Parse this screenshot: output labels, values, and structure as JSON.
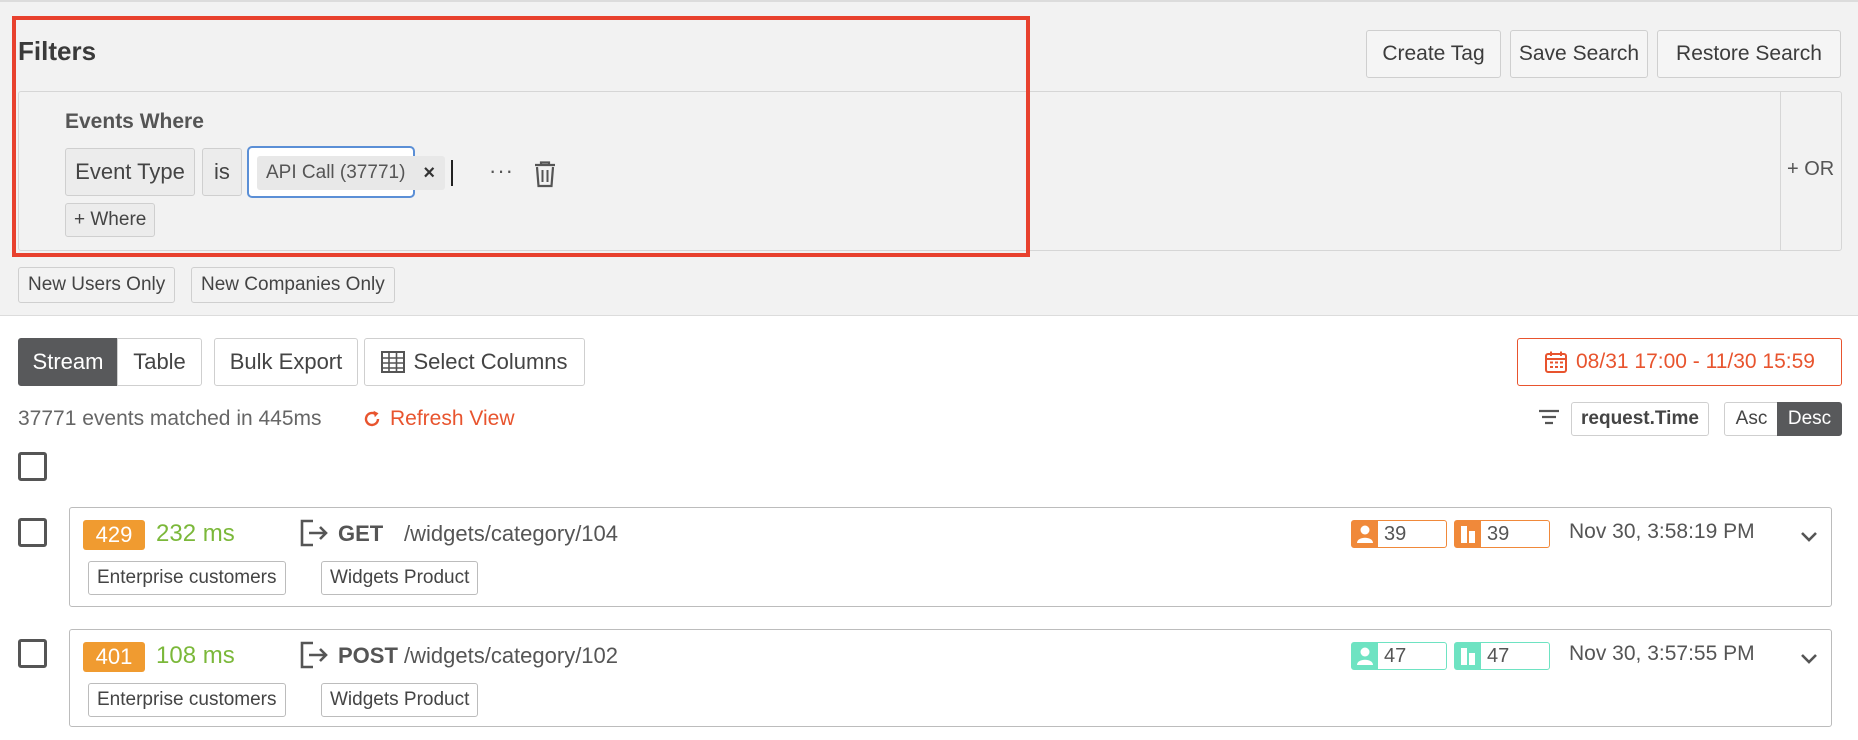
{
  "filters": {
    "title": "Filters",
    "buttons": {
      "create_tag": "Create Tag",
      "save_search": "Save Search",
      "restore_search": "Restore Search"
    },
    "group": {
      "heading": "Events Where",
      "field": "Event Type",
      "operator": "is",
      "value_tag": "API Call (37771)",
      "more": "···",
      "add_where": "+ Where",
      "or_label": "+ OR"
    },
    "quick": {
      "new_users": "New Users Only",
      "new_companies": "New Companies Only"
    }
  },
  "view": {
    "stream": "Stream",
    "table": "Table",
    "bulk_export": "Bulk Export",
    "select_columns": "Select Columns",
    "date_range": "08/31 17:00 - 11/30 15:59",
    "matched": "37771 events matched in 445ms",
    "refresh": "Refresh View",
    "sort_field": "request.Time",
    "asc": "Asc",
    "desc": "Desc",
    "sort_active": "Desc"
  },
  "colors": {
    "accent": "#e8542e",
    "highlight": "#e8412e",
    "badge": "#f09b30",
    "latency": "#7bb83a",
    "user_orange": "#f0893a",
    "user_teal": "#6ee3c2"
  },
  "events": [
    {
      "status": "429",
      "latency": "232 ms",
      "method": "GET",
      "path": "/widgets/category/104",
      "tags": [
        "Enterprise customers",
        "Widgets Product"
      ],
      "user_count": "39",
      "company_count": "39",
      "id_color": "orange",
      "time": "Nov 30, 3:58:19 PM"
    },
    {
      "status": "401",
      "latency": "108 ms",
      "method": "POST",
      "path": "/widgets/category/102",
      "tags": [
        "Enterprise customers",
        "Widgets Product"
      ],
      "user_count": "47",
      "company_count": "47",
      "id_color": "teal",
      "time": "Nov 30, 3:57:55 PM"
    }
  ]
}
